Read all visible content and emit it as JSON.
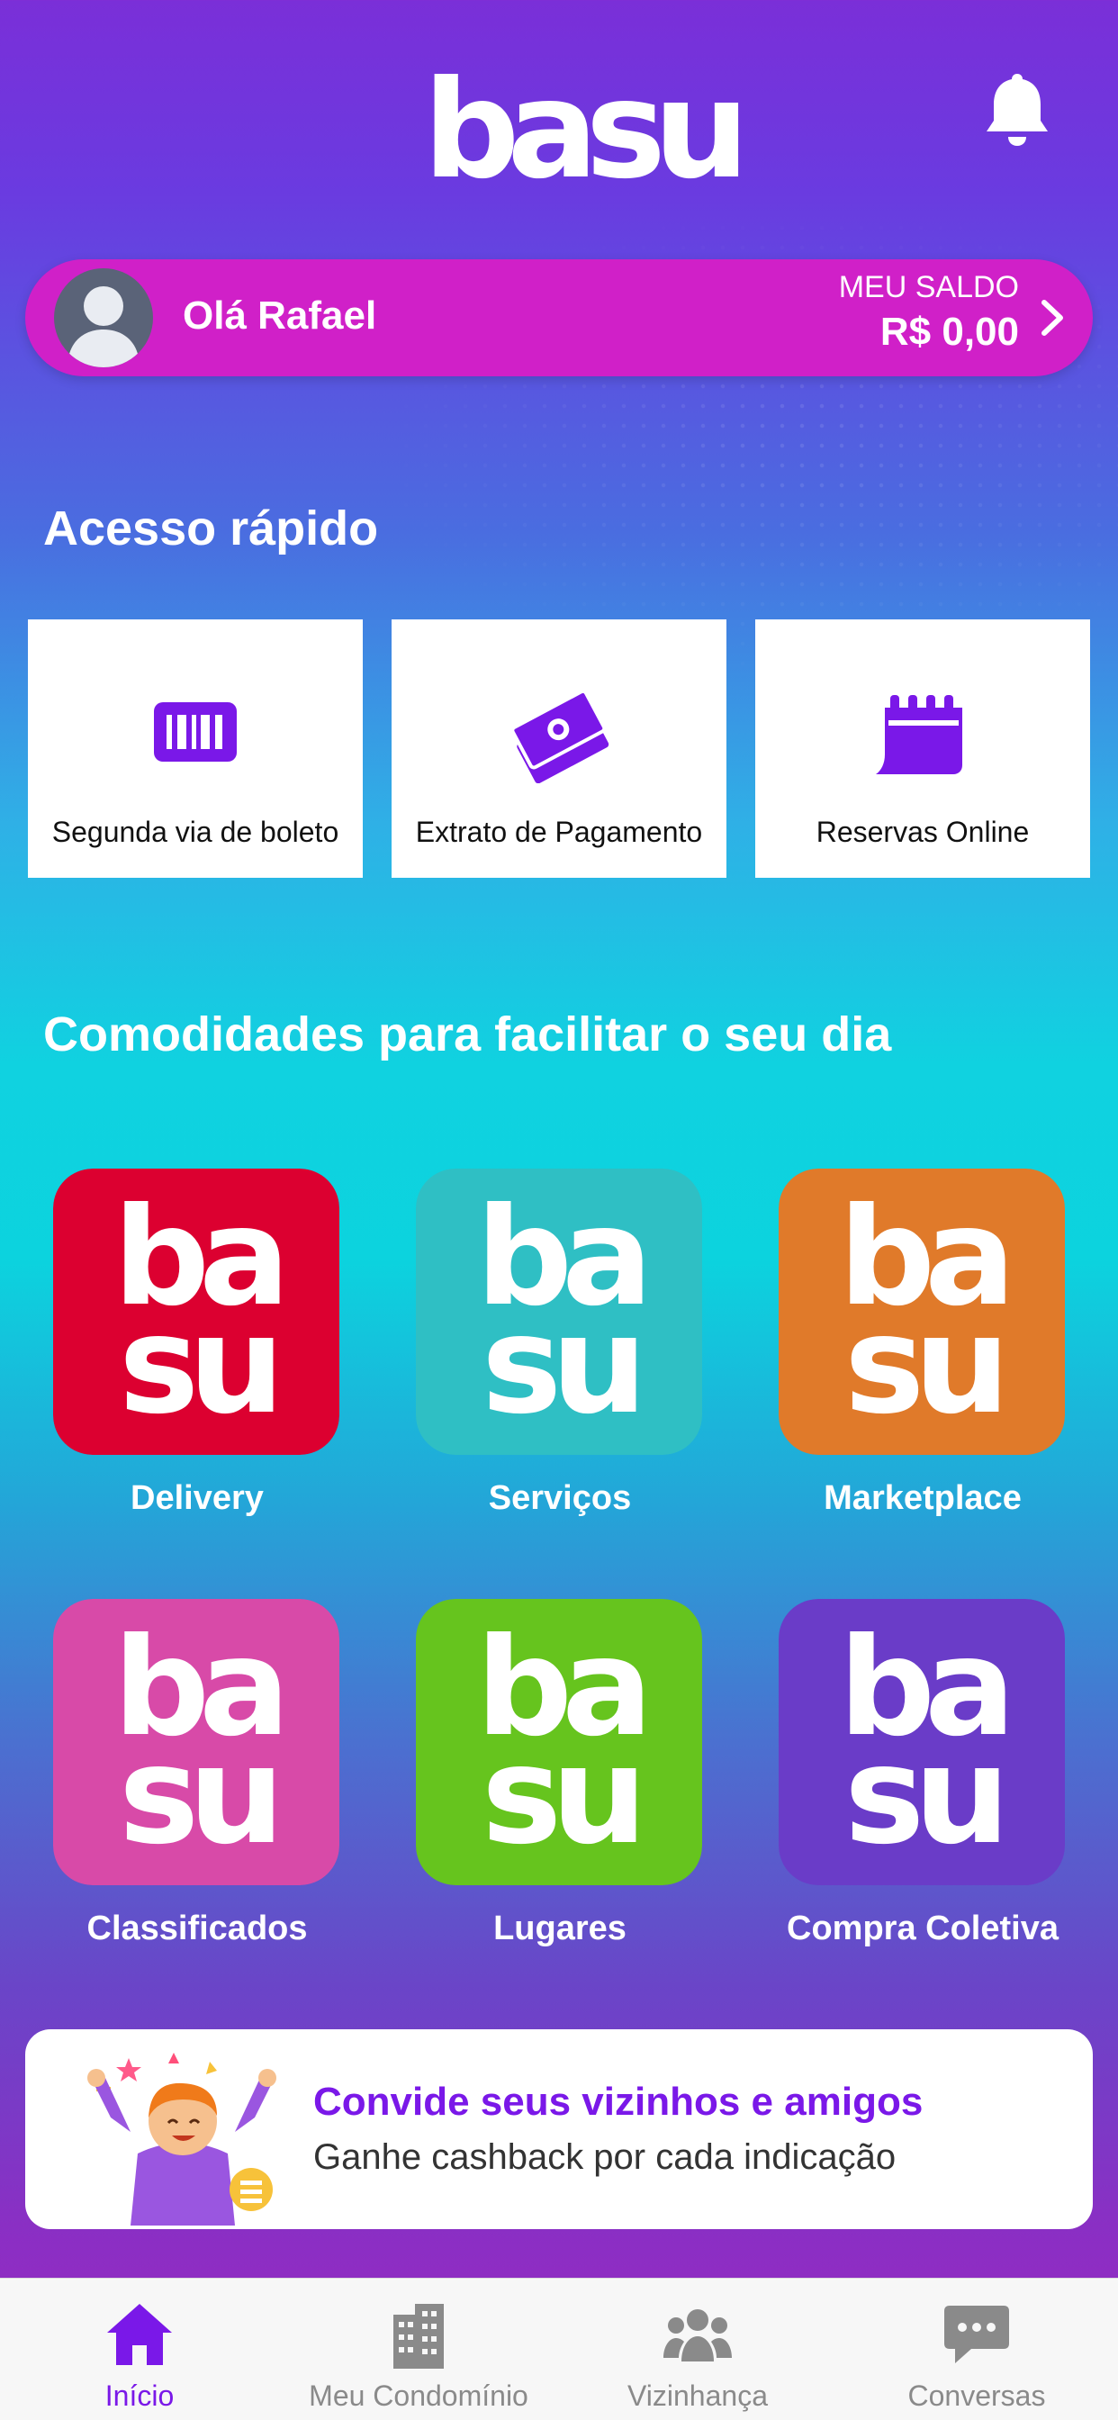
{
  "header": {
    "logo_text": "basu",
    "notifications_icon": "bell-icon"
  },
  "balance": {
    "greeting": "Olá Rafael",
    "label": "MEU SALDO",
    "value": "R$ 0,00",
    "avatar_icon": "user-avatar-icon",
    "chevron_icon": "chevron-right-icon"
  },
  "quick_access": {
    "title": "Acesso rápido",
    "items": [
      {
        "label": "Segunda via de boleto",
        "icon": "barcode-icon"
      },
      {
        "label": "Extrato de Pagamento",
        "icon": "money-icon"
      },
      {
        "label": "Reservas Online",
        "icon": "calendar-icon"
      }
    ]
  },
  "amenities": {
    "title": "Comodidades para facilitar o seu dia",
    "tile_logo_top": "ba",
    "tile_logo_bottom": "su",
    "items": [
      {
        "label": "Delivery",
        "color": "#dc0030"
      },
      {
        "label": "Serviços",
        "color": "#2fbfc4"
      },
      {
        "label": "Marketplace",
        "color": "#e07a2a"
      },
      {
        "label": "Classificados",
        "color": "#d84aa8"
      },
      {
        "label": "Lugares",
        "color": "#66c41e"
      },
      {
        "label": "Compra Coletiva",
        "color": "#6a3cc8"
      }
    ]
  },
  "invite": {
    "title": "Convide seus vizinhos e amigos",
    "subtitle": "Ganhe cashback por cada indicação"
  },
  "tabbar": {
    "items": [
      {
        "label": "Início",
        "icon": "home-icon",
        "active": true
      },
      {
        "label": "Meu Condomínio",
        "icon": "building-icon",
        "active": false
      },
      {
        "label": "Vizinhança",
        "icon": "people-icon",
        "active": false
      },
      {
        "label": "Conversas",
        "icon": "chat-icon",
        "active": false
      }
    ]
  },
  "colors": {
    "accent": "#7a18e8",
    "balance_bar": "#d020c8",
    "tab_inactive": "#8a8a8a"
  }
}
